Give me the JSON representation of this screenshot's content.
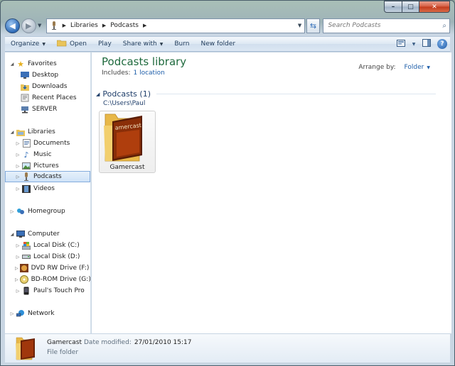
{
  "window": {
    "caption_buttons": {
      "minimize": "–",
      "maximize": "□",
      "close": "✕"
    }
  },
  "nav": {
    "back_icon": "back-arrow-icon",
    "forward_icon": "forward-arrow-icon",
    "breadcrumbs": [
      "Libraries",
      "Podcasts"
    ],
    "search_placeholder": "Search Podcasts"
  },
  "commands": {
    "organize": "Organize",
    "open": "Open",
    "play": "Play",
    "share_with": "Share with",
    "burn": "Burn",
    "new_folder": "New folder",
    "help": "?"
  },
  "sidebar": {
    "favorites": {
      "label": "Favorites",
      "items": [
        "Desktop",
        "Downloads",
        "Recent Places",
        "SERVER"
      ]
    },
    "libraries": {
      "label": "Libraries",
      "items": [
        "Documents",
        "Music",
        "Pictures",
        "Podcasts",
        "Videos"
      ]
    },
    "homegroup": {
      "label": "Homegroup"
    },
    "computer": {
      "label": "Computer",
      "items": [
        "Local Disk (C:)",
        "Local Disk (D:)",
        "DVD RW Drive (F:) Z'",
        "BD-ROM Drive (G:) F",
        "Paul's Touch Pro"
      ]
    },
    "network": {
      "label": "Network"
    }
  },
  "content": {
    "title": "Podcasts library",
    "includes_label": "Includes:",
    "includes_link": "1 location",
    "arrange_by_label": "Arrange by:",
    "arrange_by_value": "Folder",
    "group_title": "Podcasts (1)",
    "group_path": "C:\\Users\\Paul",
    "items": [
      {
        "name": "Gamercast",
        "cover_text": "amercast"
      }
    ]
  },
  "details": {
    "name": "Gamercast",
    "modified_label": "Date modified:",
    "modified_value": "27/01/2010 15:17",
    "type": "File folder"
  },
  "colors": {
    "accent": "#1f5faa",
    "library_title": "#1f6a3e",
    "selection": "#cfe3f8"
  }
}
